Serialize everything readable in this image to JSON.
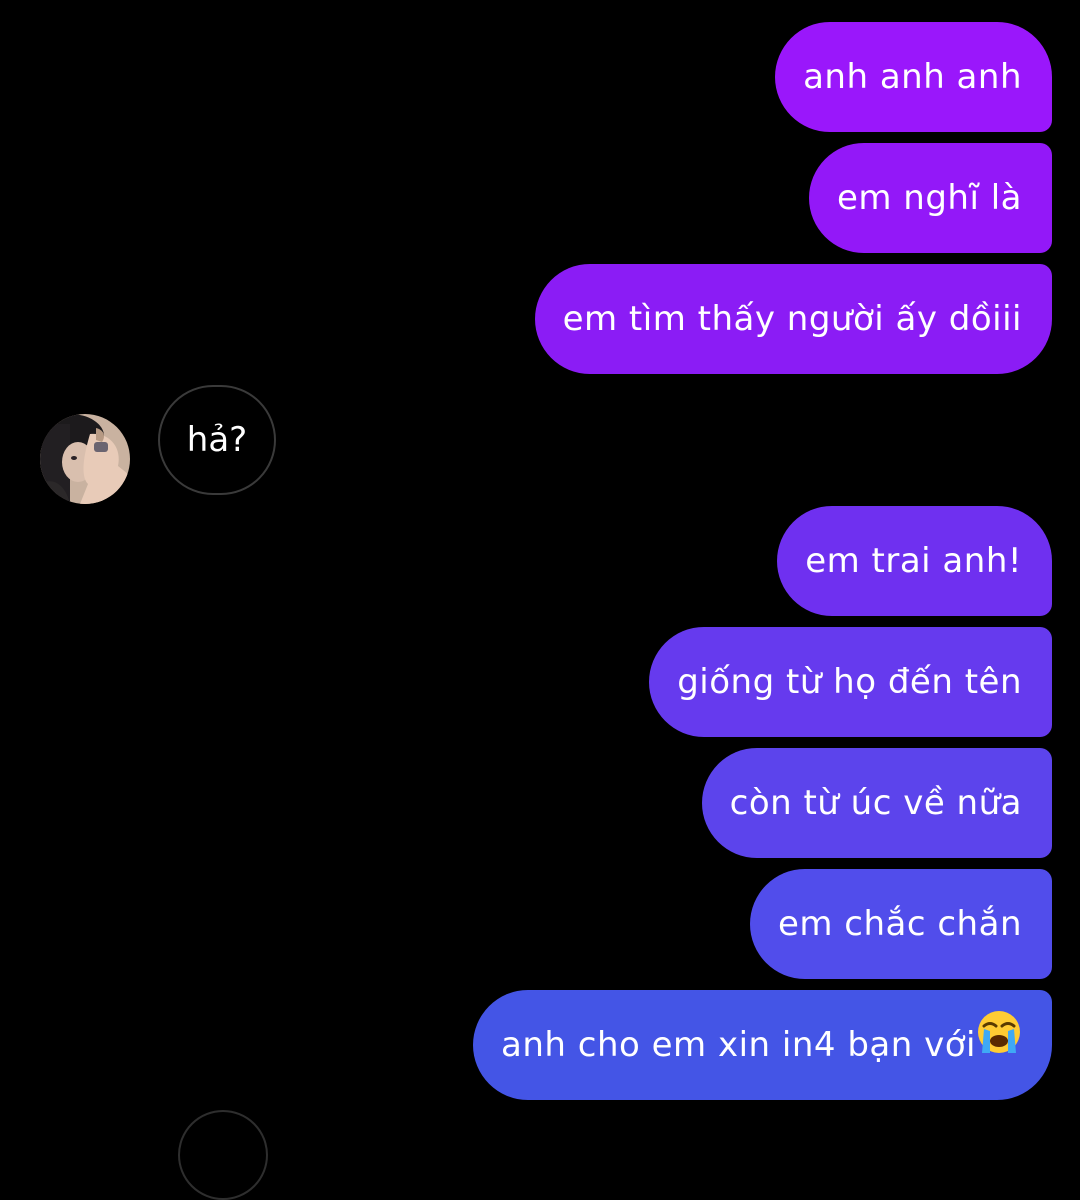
{
  "conversation": {
    "outgoing_top": [
      "anh anh anh",
      "em nghĩ là",
      "em tìm thấy người ấy dồiii"
    ],
    "incoming": {
      "text": "hả?"
    },
    "outgoing_bottom": [
      "em trai anh!",
      "giống từ họ  đến tên",
      "còn từ úc về nữa",
      "em chắc chắn",
      "anh cho em xin in4 bạn với"
    ],
    "emoji": "loudly-crying-face-icon"
  },
  "colors": {
    "background": "#000000",
    "bubble_top": "#9a17fb",
    "bubble_bottom": "#4455e6",
    "incoming_border": "#3a3a3a",
    "text": "#ffffff"
  }
}
